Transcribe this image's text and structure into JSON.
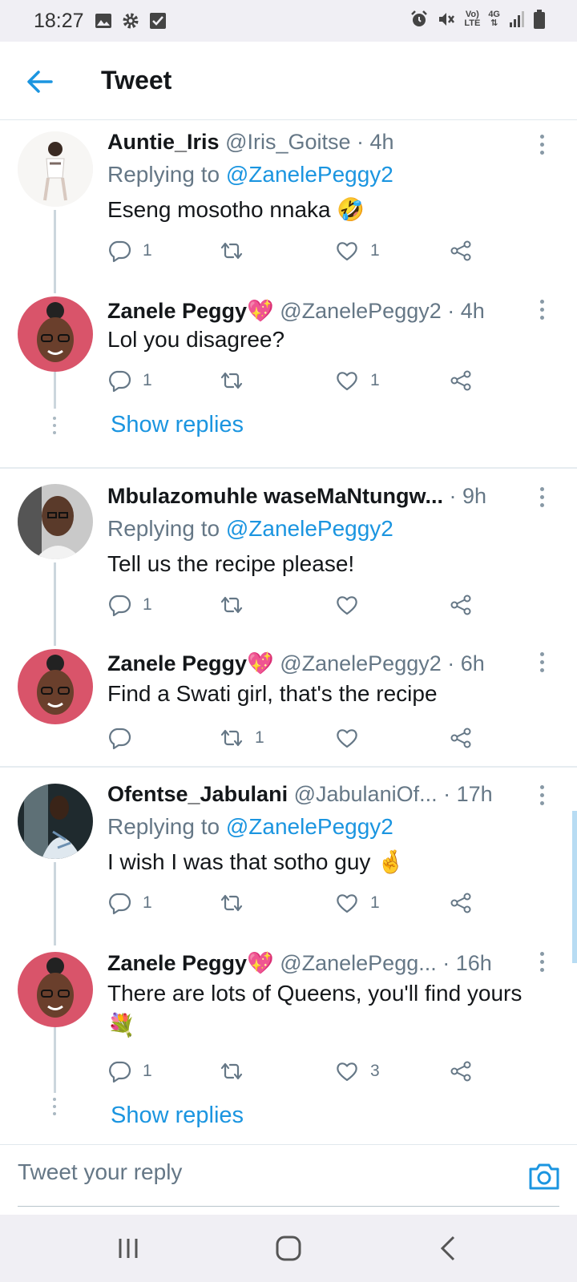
{
  "status_bar": {
    "time": "18:27",
    "network_top": "Vo)",
    "network_bottom": "LTE",
    "signal_label": "4G"
  },
  "header": {
    "title": "Tweet"
  },
  "tweets": [
    {
      "name": "Auntie_Iris",
      "handle": "@Iris_Goitse",
      "time": "· 4h",
      "replying_prefix": "Replying to ",
      "replying_to": "@ZanelePeggy2",
      "text": "Eseng mosotho nnaka 🤣",
      "replies": "1",
      "retweets": "",
      "likes": "1"
    },
    {
      "name": "Zanele Peggy💖",
      "handle": "@ZanelePeggy2",
      "time": "· 4h",
      "text": "Lol you disagree?",
      "replies": "1",
      "retweets": "",
      "likes": "1"
    },
    {
      "name": "Mbulazomuhle waseMaNtungw...",
      "handle": "",
      "time": "· 9h",
      "replying_prefix": "Replying to ",
      "replying_to": "@ZanelePeggy2",
      "text": "Tell us the recipe please!",
      "replies": "1",
      "retweets": "",
      "likes": ""
    },
    {
      "name": "Zanele Peggy💖",
      "handle": "@ZanelePeggy2",
      "time": "· 6h",
      "text": "Find a Swati girl, that's the recipe",
      "replies": "",
      "retweets": "1",
      "likes": ""
    },
    {
      "name": "Ofentse_Jabulani",
      "handle": "@JabulaniOf...",
      "time": "· 17h",
      "replying_prefix": "Replying to ",
      "replying_to": "@ZanelePeggy2",
      "text": "I wish I was that sotho guy 🤞",
      "replies": "1",
      "retweets": "",
      "likes": "1"
    },
    {
      "name": "Zanele Peggy💖",
      "handle": "@ZanelePegg...",
      "time": "· 16h",
      "text": "There are lots of Queens, you'll find yours 💐",
      "replies": "1",
      "retweets": "",
      "likes": "3"
    }
  ],
  "show_replies_label": "Show replies",
  "composer": {
    "placeholder": "Tweet your reply"
  },
  "colors": {
    "accent": "#1b95e0",
    "muted": "#657786",
    "divider": "#e6ecf0"
  }
}
